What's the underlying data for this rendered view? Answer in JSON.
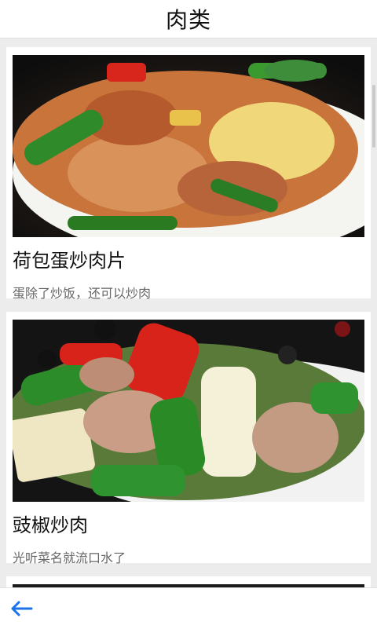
{
  "header": {
    "title": "肉类"
  },
  "colors": {
    "accent": "#1a73e8",
    "background": "#ececec"
  },
  "recipes": [
    {
      "name": "荷包蛋炒肉片",
      "description": "蛋除了炒饭，还可以炒肉"
    },
    {
      "name": "豉椒炒肉",
      "description": "光听菜名就流口水了"
    },
    {
      "name": "",
      "description": ""
    }
  ],
  "footer": {
    "back_icon": "arrow-left-icon"
  }
}
